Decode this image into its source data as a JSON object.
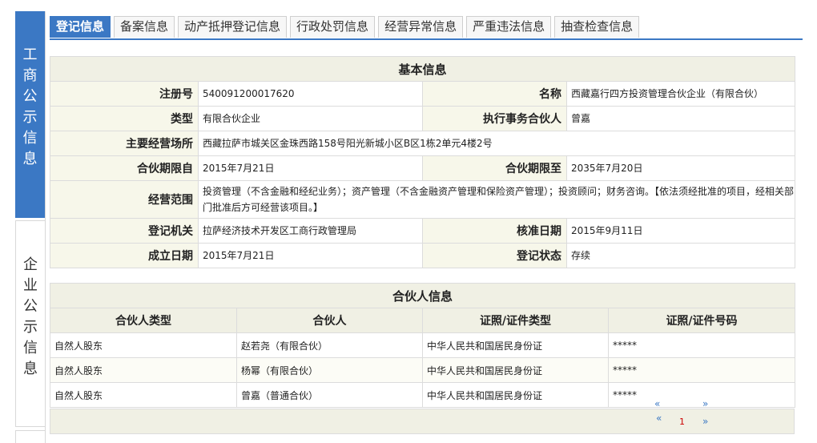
{
  "sidebar": {
    "items": [
      {
        "label": "工商公示信息"
      },
      {
        "label": "企业公示信息"
      }
    ]
  },
  "tabs": [
    {
      "label": "登记信息"
    },
    {
      "label": "备案信息"
    },
    {
      "label": "动产抵押登记信息"
    },
    {
      "label": "行政处罚信息"
    },
    {
      "label": "经营异常信息"
    },
    {
      "label": "严重违法信息"
    },
    {
      "label": "抽查检查信息"
    }
  ],
  "basic": {
    "title": "基本信息",
    "reg_no_label": "注册号",
    "reg_no": "540091200017620",
    "name_label": "名称",
    "name": "西藏嘉行四方投资管理合伙企业（有限合伙）",
    "type_label": "类型",
    "type": "有限合伙企业",
    "partner_label": "执行事务合伙人",
    "partner": "曾嘉",
    "place_label": "主要经营场所",
    "place": "西藏拉萨市城关区金珠西路158号阳光新城小区B区1栋2单元4楼2号",
    "from_label": "合伙期限自",
    "from": "2015年7月21日",
    "to_label": "合伙期限至",
    "to": "2035年7月20日",
    "scope_label": "经营范围",
    "scope": "投资管理（不含金融和经纪业务）；资产管理（不含金融资产管理和保险资产管理）；投资顾问；财务咨询。【依法须经批准的项目，经相关部门批准后方可经营该项目。】",
    "authority_label": "登记机关",
    "authority": "拉萨经济技术开发区工商行政管理局",
    "approve_label": "核准日期",
    "approve": "2015年9月11日",
    "founded_label": "成立日期",
    "founded": "2015年7月21日",
    "status_label": "登记状态",
    "status": "存续"
  },
  "partners": {
    "title": "合伙人信息",
    "headers": [
      "合伙人类型",
      "合伙人",
      "证照/证件类型",
      "证照/证件号码"
    ],
    "rows": [
      [
        "自然人股东",
        "赵若尧（有限合伙）",
        "中华人民共和国居民身份证",
        "*****"
      ],
      [
        "自然人股东",
        "杨幂（有限合伙）",
        "中华人民共和国居民身份证",
        "*****"
      ],
      [
        "自然人股东",
        "曾嘉（普通合伙）",
        "中华人民共和国居民身份证",
        "*****"
      ]
    ]
  },
  "pager": {
    "first": "«",
    "prev": "«",
    "next": "»",
    "last": "»",
    "page": "1"
  },
  "colors": {
    "accent": "#3b78c4",
    "label_bg": "#f7f7ea",
    "header_bg": "#f0f0e4"
  }
}
